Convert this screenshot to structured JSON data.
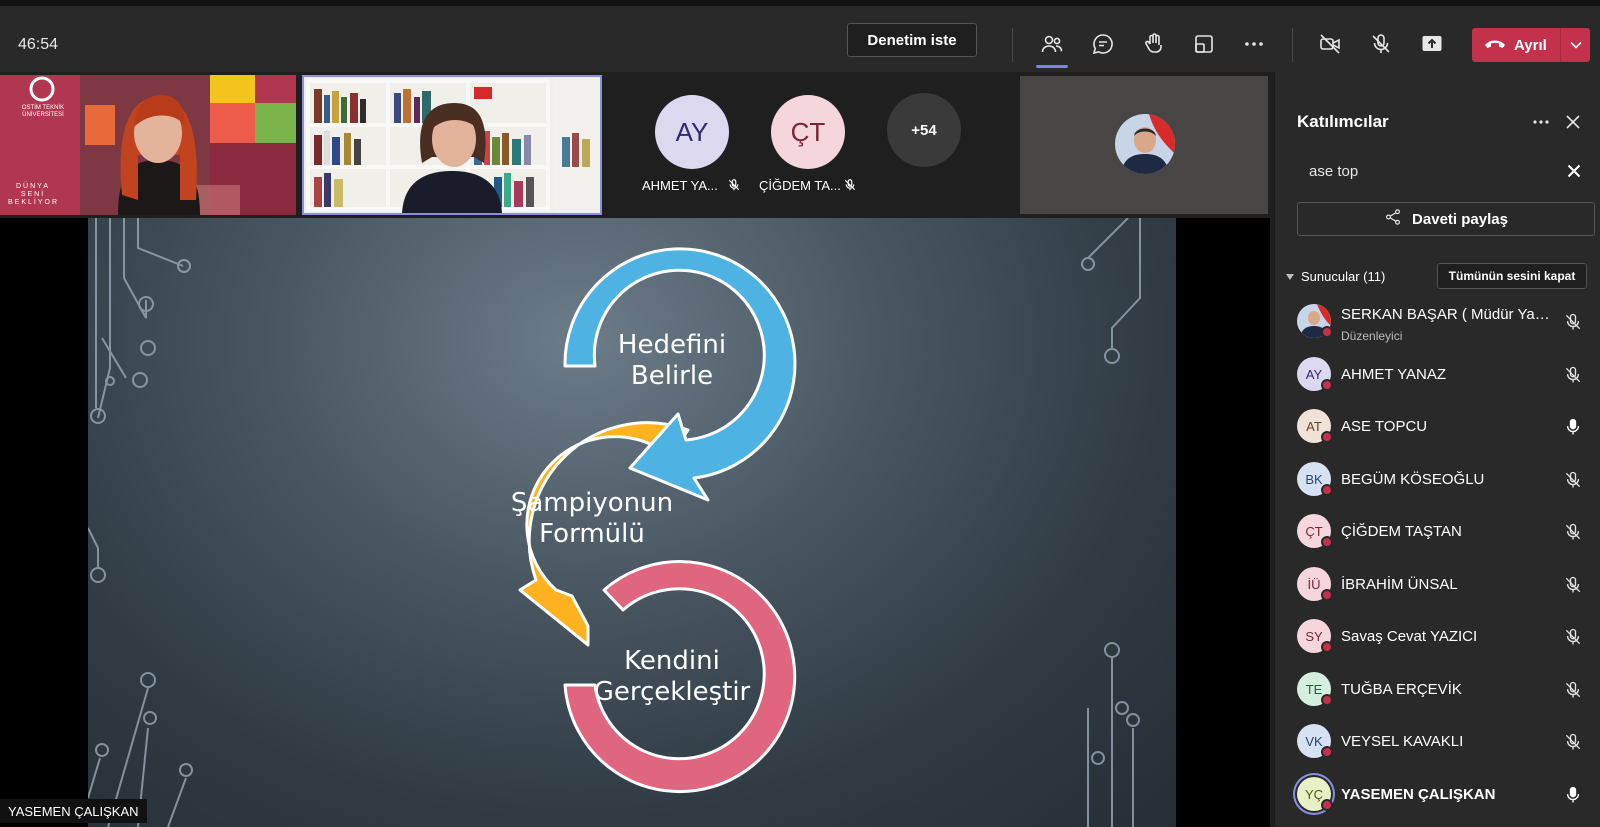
{
  "toolbar": {
    "timer": "46:54",
    "record_label": "Denetim iste",
    "leave_label": "Ayrıl",
    "accent": "#c4314b"
  },
  "video_strip": {
    "overflow_count": "+54",
    "avatars": [
      {
        "initials": "AY",
        "name": "AHMET YA...",
        "bg": "#dcd8f0",
        "fg": "#2f2a6e"
      },
      {
        "initials": "ÇT",
        "name": "ÇİĞDEM TA...",
        "bg": "#f4d6dc",
        "fg": "#7a2436"
      }
    ],
    "logo_text": "OSTİM TEKNİK ÜNİVERSİTESİ",
    "banner_text": "DÜNYA SENİ BEKLİYOR"
  },
  "slide": {
    "step1": [
      "Hedefini",
      "Belirle"
    ],
    "step2": [
      "Şampiyonun",
      "Formülü"
    ],
    "step3": [
      "Kendini",
      "Gerçekleştir"
    ],
    "colors": {
      "blue": "#4eb3e3",
      "yellow": "#ffb21f",
      "pink": "#e0657e"
    }
  },
  "presenter_caption": "YASEMEN ÇALIŞKAN",
  "panel": {
    "title": "Katılımcılar",
    "search_value": "ase top",
    "invite_label": "Daveti paylaş",
    "section_label": "Sunucular (11)",
    "mute_all_label": "Tümünün sesini kapat",
    "people": [
      {
        "initials": "",
        "name": "SERKAN BAŞAR ( Müdür Yard...",
        "role": "Düzenleyici",
        "bg": "#5a7ca8",
        "fg": "#fff",
        "muted": true
      },
      {
        "initials": "AY",
        "name": "AHMET YANAZ",
        "role": "",
        "bg": "#dcd8f0",
        "fg": "#2f2a6e",
        "muted": true
      },
      {
        "initials": "AT",
        "name": "ASE TOPCU",
        "role": "",
        "bg": "#efe2d8",
        "fg": "#6b3d22",
        "muted": false
      },
      {
        "initials": "BK",
        "name": "BEGÜM KÖSEOĞLU",
        "role": "",
        "bg": "#d6e2f2",
        "fg": "#24467a",
        "muted": true
      },
      {
        "initials": "ÇT",
        "name": "ÇİĞDEM TAŞTAN",
        "role": "",
        "bg": "#f4d6dc",
        "fg": "#7a2436",
        "muted": true
      },
      {
        "initials": "İÜ",
        "name": "İBRAHİM ÜNSAL",
        "role": "",
        "bg": "#f4d6dc",
        "fg": "#7a2436",
        "muted": true
      },
      {
        "initials": "SY",
        "name": "Savaş Cevat YAZICI",
        "role": "",
        "bg": "#f4d6dc",
        "fg": "#7a2436",
        "muted": true
      },
      {
        "initials": "TE",
        "name": "TUĞBA ERÇEVİK",
        "role": "",
        "bg": "#d4efe0",
        "fg": "#1f6040",
        "muted": true
      },
      {
        "initials": "VK",
        "name": "VEYSEL KAVAKLI",
        "role": "",
        "bg": "#d6e2f2",
        "fg": "#24467a",
        "muted": true
      },
      {
        "initials": "YÇ",
        "name": "YASEMEN ÇALIŞKAN",
        "role": "",
        "bg": "#e8f0c8",
        "fg": "#4a5a10",
        "muted": false
      }
    ]
  }
}
